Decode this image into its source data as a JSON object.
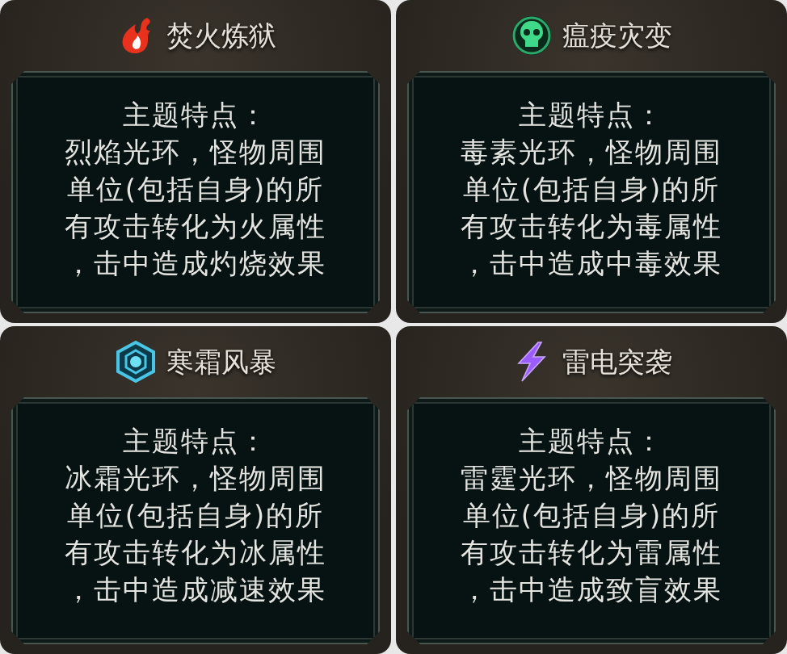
{
  "cards": [
    {
      "kind": "fire",
      "title": "焚火炼狱",
      "heading": "主题特点：",
      "lines": [
        "烈焰光环，怪物周围",
        "单位(包括自身)的所",
        "有攻击转化为火属性",
        "，击中造成灼烧效果"
      ]
    },
    {
      "kind": "plague",
      "title": "瘟疫灾变",
      "heading": "主题特点：",
      "lines": [
        "毒素光环，怪物周围",
        "单位(包括自身)的所",
        "有攻击转化为毒属性",
        "，击中造成中毒效果"
      ]
    },
    {
      "kind": "frost",
      "title": "寒霜风暴",
      "heading": "主题特点：",
      "lines": [
        "冰霜光环，怪物周围",
        "单位(包括自身)的所",
        "有攻击转化为冰属性",
        "，击中造成减速效果"
      ]
    },
    {
      "kind": "thunder",
      "title": "雷电突袭",
      "heading": "主题特点：",
      "lines": [
        "雷霆光环，怪物周围",
        "单位(包括自身)的所",
        "有攻击转化为雷属性",
        "，击中造成致盲效果"
      ]
    }
  ]
}
